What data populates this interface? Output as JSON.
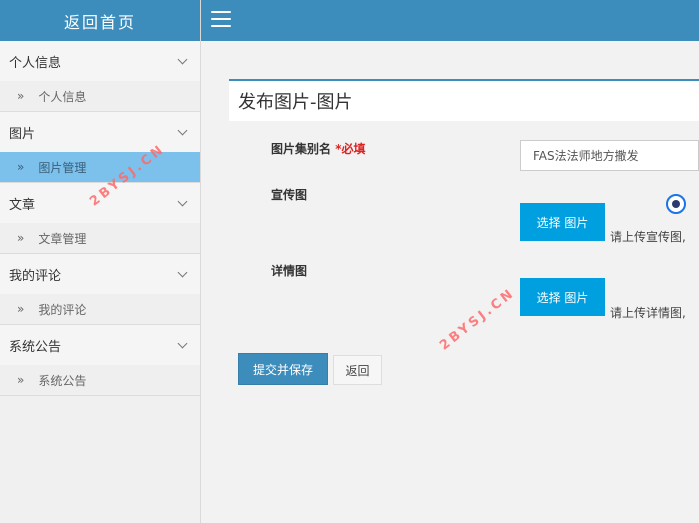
{
  "sidebar": {
    "home_label": "返回首页",
    "groups": [
      {
        "title": "个人信息",
        "items": [
          "个人信息"
        ]
      },
      {
        "title": "图片",
        "items": [
          "图片管理"
        ]
      },
      {
        "title": "文章",
        "items": [
          "文章管理"
        ]
      },
      {
        "title": "我的评论",
        "items": [
          "我的评论"
        ]
      },
      {
        "title": "系统公告",
        "items": [
          "系统公告"
        ]
      }
    ],
    "active_item": "图片管理",
    "sub_marker": "»"
  },
  "page": {
    "title": "发布图片-图片"
  },
  "form": {
    "collection_label": "图片集别名",
    "required_marker": "*必填",
    "collection_value": "FAS法法师地方撒发",
    "promo_label": "宣传图",
    "promo_button": "选择 图片",
    "promo_hint": "请上传宣传图,",
    "detail_label": "详情图",
    "detail_button": "选择 图片",
    "detail_hint": "请上传详情图,"
  },
  "actions": {
    "submit": "提交并保存",
    "back": "返回"
  },
  "watermark": "2BYSJ.CN",
  "colors": {
    "header_blue": "#3c8dbc",
    "active_item_bg": "#7cc0ec",
    "select_button": "#00a0e0",
    "required_red": "#dd2222"
  }
}
